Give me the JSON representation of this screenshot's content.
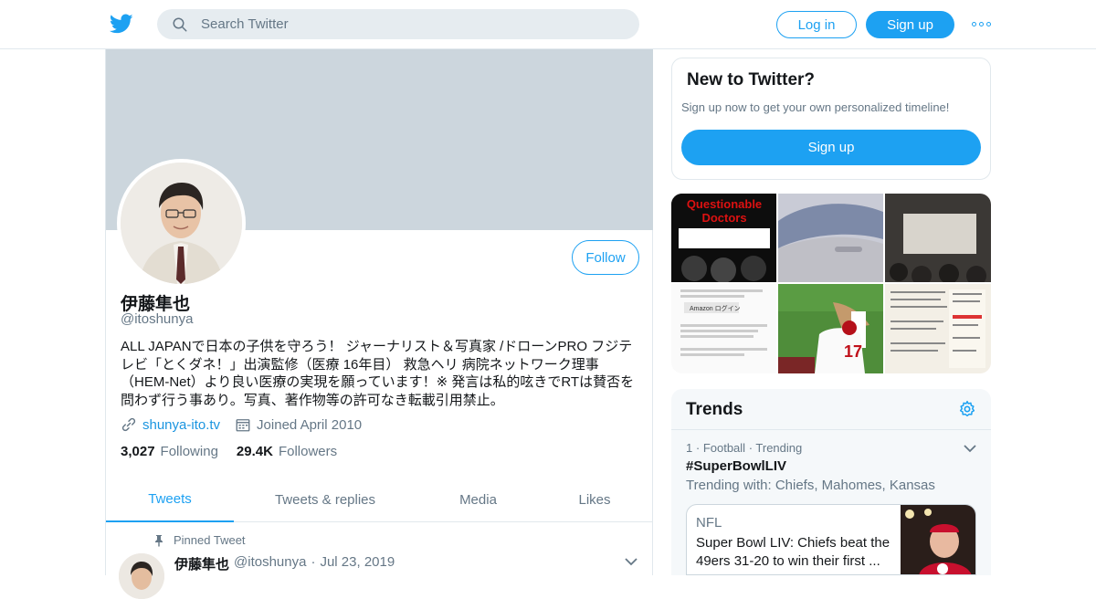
{
  "header": {
    "search_placeholder": "Search Twitter",
    "login_label": "Log in",
    "signup_label": "Sign up",
    "brand_color": "#1da1f2"
  },
  "profile": {
    "name": "伊藤隼也",
    "handle": "@itoshunya",
    "follow_label": "Follow",
    "bio_lines": [
      "ALL JAPANで日本の子供を守ろう！ ジャーナリスト＆写真家 /ドローンPRO フジテ",
      "レビ「とくダネ！」出演監修（医療 16年目） 救急ヘリ 病院ネットワーク理事",
      "（HEM-Net）より良い医療の実現を願っています！※ 発言は私的呟きでRTは賛否を",
      "問わず行う事あり。写真、著作物等の許可なき転載引用禁止。"
    ],
    "website": "shunya-ito.tv",
    "joined": "Joined April 2010",
    "following_count": "3,027",
    "following_label": "Following",
    "followers_count": "29.4K",
    "followers_label": "Followers"
  },
  "tabs": [
    "Tweets",
    "Tweets & replies",
    "Media",
    "Likes"
  ],
  "pinned": {
    "label": "Pinned Tweet",
    "name": "伊藤隼也",
    "handle": "@itoshunya",
    "date": "Jul 23, 2019"
  },
  "signup_panel": {
    "title": "New to Twitter?",
    "subtitle": "Sign up now to get your own personalized timeline!",
    "button": "Sign up"
  },
  "media_tiles": {
    "book_title_1": "Questionable",
    "book_title_2": "Doctors",
    "amazon_label": "Amazon ログイン",
    "jersey_number": "17"
  },
  "trends": {
    "title": "Trends",
    "item": {
      "rank": "1",
      "category": "Football",
      "status": "Trending",
      "tag": "#SuperBowlLIV",
      "with": "Trending with: Chiefs, Mahomes, Kansas"
    },
    "news": {
      "source": "NFL",
      "text": "Super Bowl LIV: Chiefs beat the 49ers 31-20 to win their first ..."
    }
  }
}
